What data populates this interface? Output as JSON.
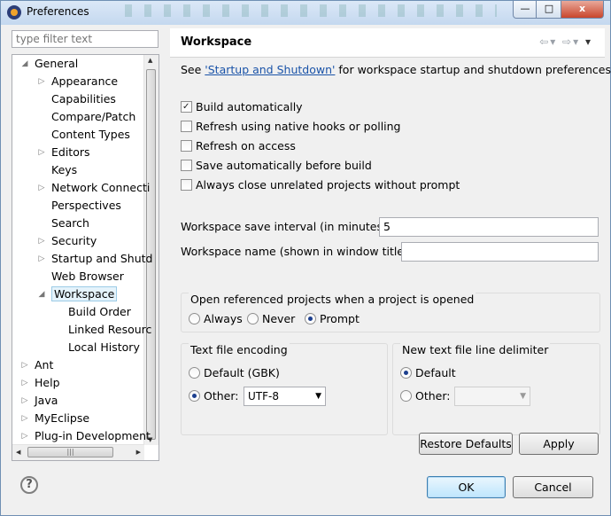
{
  "window": {
    "title": "Preferences",
    "min_label": "—",
    "max_label": "□",
    "close_label": "x"
  },
  "filter": {
    "placeholder": "type filter text"
  },
  "tree": [
    {
      "label": "General",
      "indent": 0,
      "expanded": true
    },
    {
      "label": "Appearance",
      "indent": 1,
      "expandable": true
    },
    {
      "label": "Capabilities",
      "indent": 1
    },
    {
      "label": "Compare/Patch",
      "indent": 1
    },
    {
      "label": "Content Types",
      "indent": 1
    },
    {
      "label": "Editors",
      "indent": 1,
      "expandable": true
    },
    {
      "label": "Keys",
      "indent": 1
    },
    {
      "label": "Network Connecti",
      "indent": 1,
      "expandable": true
    },
    {
      "label": "Perspectives",
      "indent": 1
    },
    {
      "label": "Search",
      "indent": 1
    },
    {
      "label": "Security",
      "indent": 1,
      "expandable": true
    },
    {
      "label": "Startup and Shutd",
      "indent": 1,
      "expandable": true
    },
    {
      "label": "Web Browser",
      "indent": 1
    },
    {
      "label": "Workspace",
      "indent": 1,
      "expanded": true,
      "selected": true
    },
    {
      "label": "Build Order",
      "indent": 2
    },
    {
      "label": "Linked Resourc",
      "indent": 2
    },
    {
      "label": "Local History",
      "indent": 2
    },
    {
      "label": "Ant",
      "indent": 0,
      "expandable": true
    },
    {
      "label": "Help",
      "indent": 0,
      "expandable": true
    },
    {
      "label": "Java",
      "indent": 0,
      "expandable": true
    },
    {
      "label": "MyEclipse",
      "indent": 0,
      "expandable": true
    },
    {
      "label": "Plug-in Development",
      "indent": 0,
      "expandable": true
    }
  ],
  "page": {
    "title": "Workspace",
    "see_prefix": "See ",
    "see_link": "'Startup and Shutdown'",
    "see_suffix": " for workspace startup and shutdown preferences.",
    "checkboxes": [
      {
        "label": "Build automatically",
        "checked": true
      },
      {
        "label": "Refresh using native hooks or polling",
        "checked": false
      },
      {
        "label": "Refresh on access",
        "checked": false
      },
      {
        "label": "Save automatically before build",
        "checked": false
      },
      {
        "label": "Always close unrelated projects without prompt",
        "checked": false
      }
    ],
    "save_interval_label": "Workspace save interval (in minutes):",
    "save_interval_value": "5",
    "ws_name_label": "Workspace name (shown in window title):",
    "ws_name_value": "",
    "open_ref_title": "Open referenced projects when a project is opened",
    "open_ref_options": [
      {
        "label": "Always",
        "selected": false
      },
      {
        "label": "Never",
        "selected": false
      },
      {
        "label": "Prompt",
        "selected": true
      }
    ],
    "encoding_title": "Text file encoding",
    "encoding_default": "Default (GBK)",
    "encoding_other": "Other:",
    "encoding_value": "UTF-8",
    "delim_title": "New text file line delimiter",
    "delim_default": "Default",
    "delim_other": "Other:",
    "delim_value": ""
  },
  "buttons": {
    "restore": "Restore Defaults",
    "apply": "Apply",
    "ok": "OK",
    "cancel": "Cancel"
  },
  "icons": {
    "help": "?",
    "back": "⇦",
    "forward": "⇨",
    "menu": "▾"
  }
}
